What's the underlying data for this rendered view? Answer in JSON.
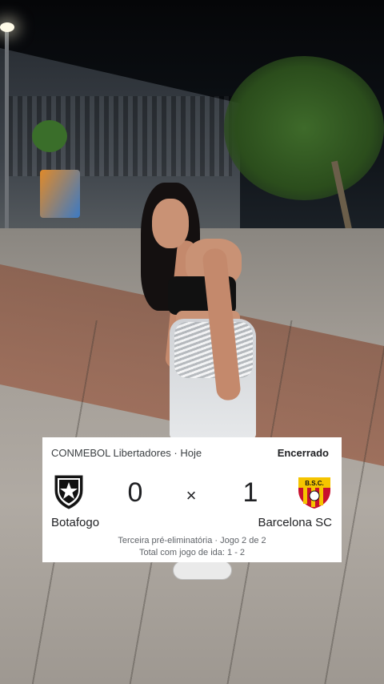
{
  "match_card": {
    "competition": "CONMEBOL Libertadores · Hoje",
    "status": "Encerrado",
    "home_team": {
      "name": "Botafogo",
      "score": "0",
      "logo_icon": "botafogo-crest-icon"
    },
    "separator": "×",
    "away_team": {
      "name": "Barcelona SC",
      "score": "1",
      "logo_icon": "barcelona-sc-crest-icon"
    },
    "round": "Terceira pré-eliminatória · Jogo 2 de 2",
    "aggregate": "Total com jogo de ida: 1 - 2"
  },
  "background": {
    "description_colors": {
      "sky": "#0d1116",
      "ground": "#a59f98",
      "brick": "#9b6651"
    }
  }
}
